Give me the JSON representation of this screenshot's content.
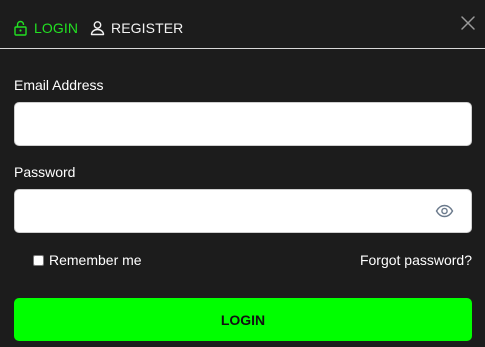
{
  "colors": {
    "background": "#1c1c1c",
    "accent": "#00ff00",
    "active_tab": "#22e022",
    "text": "#ffffff"
  },
  "tabs": [
    {
      "label": "LOGIN",
      "icon": "lock-icon",
      "active": true
    },
    {
      "label": "REGISTER",
      "icon": "user-icon",
      "active": false
    }
  ],
  "close_icon": "close-icon",
  "form": {
    "email_label": "Email Address",
    "email_value": "",
    "password_label": "Password",
    "password_value": "",
    "password_toggle_icon": "eye-icon",
    "remember_label": "Remember me",
    "remember_checked": false,
    "forgot_label": "Forgot password?",
    "submit_label": "LOGIN"
  }
}
